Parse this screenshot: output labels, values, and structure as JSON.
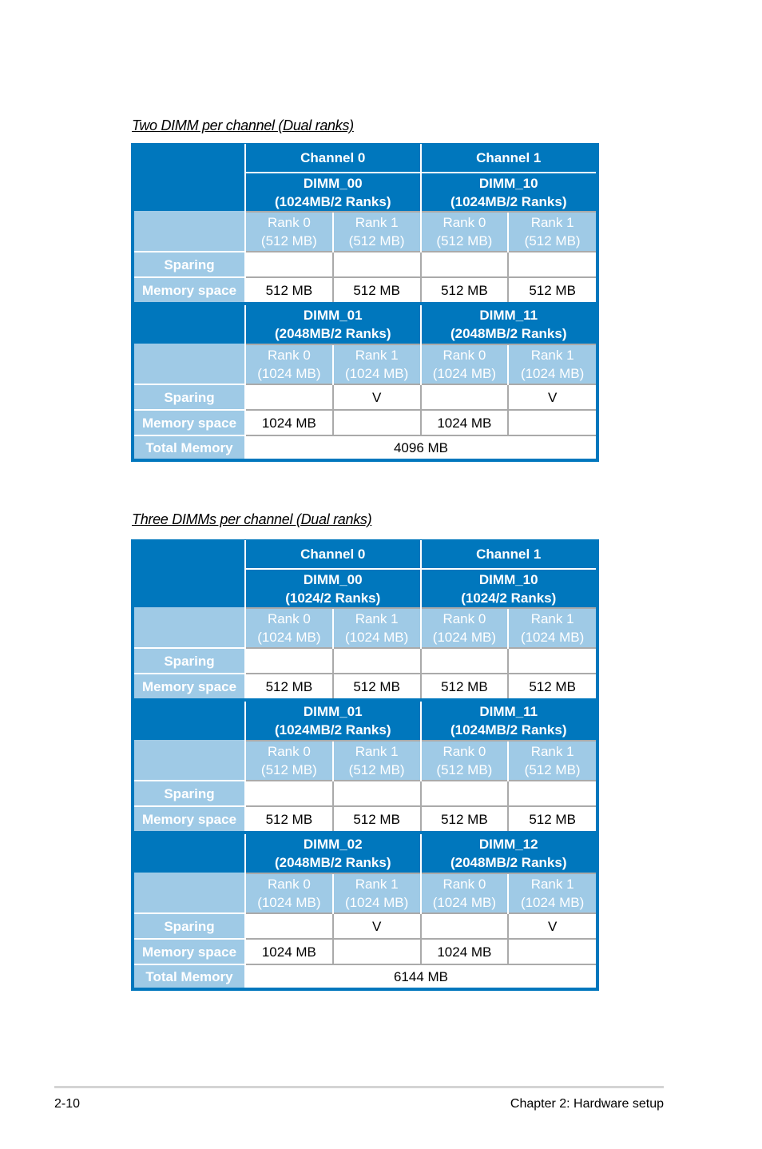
{
  "table1": {
    "caption": "Two DIMM per channel (Dual ranks)",
    "channels": [
      "Channel 0",
      "Channel 1"
    ],
    "sections": [
      {
        "dimms": [
          {
            "name": "DIMM_00",
            "size": "(1024MB/2 Ranks)"
          },
          {
            "name": "DIMM_10",
            "size": "(1024MB/2 Ranks)"
          }
        ],
        "ranks": [
          {
            "name": "Rank 0",
            "size": "(512 MB)"
          },
          {
            "name": "Rank 1",
            "size": "(512 MB)"
          },
          {
            "name": "Rank 0",
            "size": "(512 MB)"
          },
          {
            "name": "Rank 1",
            "size": "(512 MB)"
          }
        ],
        "sparing_label": "Sparing",
        "sparing": [
          "",
          "",
          "",
          ""
        ],
        "memory_label": "Memory space",
        "memory": [
          "512 MB",
          "512 MB",
          "512 MB",
          "512 MB"
        ]
      },
      {
        "dimms": [
          {
            "name": "DIMM_01",
            "size": "(2048MB/2 Ranks)"
          },
          {
            "name": "DIMM_11",
            "size": "(2048MB/2 Ranks)"
          }
        ],
        "ranks": [
          {
            "name": "Rank 0",
            "size": "(1024 MB)"
          },
          {
            "name": "Rank 1",
            "size": "(1024 MB)"
          },
          {
            "name": "Rank 0",
            "size": "(1024 MB)"
          },
          {
            "name": "Rank 1",
            "size": "(1024 MB)"
          }
        ],
        "sparing_label": "Sparing",
        "sparing": [
          "",
          "V",
          "",
          "V"
        ],
        "memory_label": "Memory space",
        "memory": [
          "1024 MB",
          "",
          "1024 MB",
          ""
        ]
      }
    ],
    "total_label": "Total Memory",
    "total": "4096 MB"
  },
  "table2": {
    "caption": "Three DIMMs per channel (Dual ranks)",
    "channels": [
      "Channel 0",
      "Channel 1"
    ],
    "sections": [
      {
        "dimms": [
          {
            "name": "DIMM_00",
            "size": "(1024/2 Ranks)"
          },
          {
            "name": "DIMM_10",
            "size": "(1024/2 Ranks)"
          }
        ],
        "ranks": [
          {
            "name": "Rank 0",
            "size": "(1024 MB)"
          },
          {
            "name": "Rank 1",
            "size": "(1024 MB)"
          },
          {
            "name": "Rank 0",
            "size": "(1024 MB)"
          },
          {
            "name": "Rank 1",
            "size": "(1024 MB)"
          }
        ],
        "sparing_label": "Sparing",
        "sparing": [
          "",
          "",
          "",
          ""
        ],
        "memory_label": "Memory space",
        "memory": [
          "512 MB",
          "512 MB",
          "512 MB",
          "512 MB"
        ]
      },
      {
        "dimms": [
          {
            "name": "DIMM_01",
            "size": "(1024MB/2 Ranks)"
          },
          {
            "name": "DIMM_11",
            "size": "(1024MB/2 Ranks)"
          }
        ],
        "ranks": [
          {
            "name": "Rank 0",
            "size": "(512 MB)"
          },
          {
            "name": "Rank 1",
            "size": "(512 MB)"
          },
          {
            "name": "Rank 0",
            "size": "(512 MB)"
          },
          {
            "name": "Rank 1",
            "size": "(512 MB)"
          }
        ],
        "sparing_label": "Sparing",
        "sparing": [
          "",
          "",
          "",
          ""
        ],
        "memory_label": "Memory space",
        "memory": [
          "512 MB",
          "512 MB",
          "512 MB",
          "512 MB"
        ]
      },
      {
        "dimms": [
          {
            "name": "DIMM_02",
            "size": "(2048MB/2 Ranks)"
          },
          {
            "name": "DIMM_12",
            "size": "(2048MB/2 Ranks)"
          }
        ],
        "ranks": [
          {
            "name": "Rank 0",
            "size": "(1024 MB)"
          },
          {
            "name": "Rank 1",
            "size": "(1024 MB)"
          },
          {
            "name": "Rank 0",
            "size": "(1024 MB)"
          },
          {
            "name": "Rank 1",
            "size": "(1024 MB)"
          }
        ],
        "sparing_label": "Sparing",
        "sparing": [
          "",
          "V",
          "",
          "V"
        ],
        "memory_label": "Memory space",
        "memory": [
          "1024 MB",
          "",
          "1024 MB",
          ""
        ]
      }
    ],
    "total_label": "Total Memory",
    "total": "6144 MB"
  },
  "footer": {
    "page_number": "2-10",
    "chapter": "Chapter 2:  Hardware setup"
  },
  "colors": {
    "header_blue": "#0077bd",
    "label_light_blue": "#9fcae6",
    "grid_gray": "#aaaaaa"
  }
}
